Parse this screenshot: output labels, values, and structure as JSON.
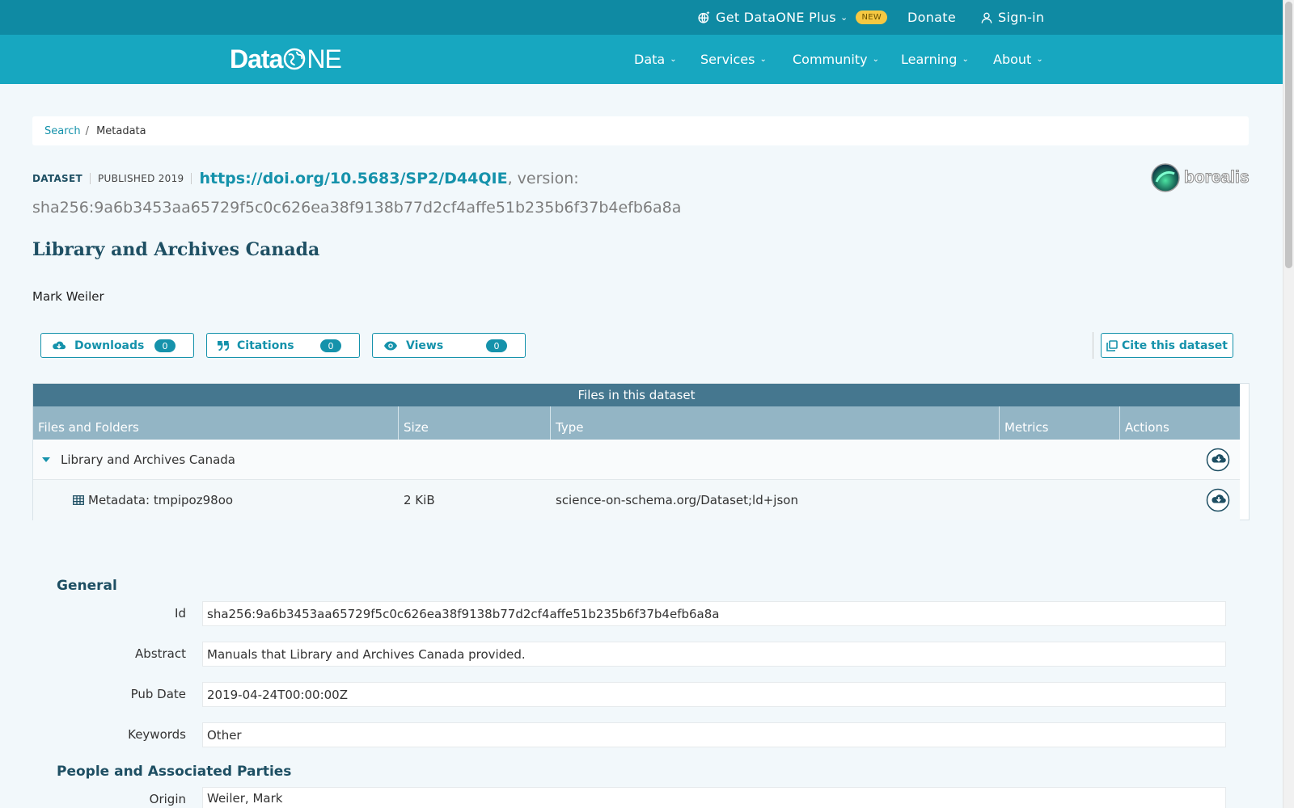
{
  "topbar": {
    "plus_label": "Get DataONE Plus",
    "new_badge": "NEW",
    "donate_label": "Donate",
    "signin_label": "Sign-in"
  },
  "nav": {
    "logo_data": "Data",
    "logo_ne": "NE",
    "items": [
      "Data",
      "Services",
      "Community",
      "Learning",
      "About"
    ]
  },
  "breadcrumb": {
    "search": "Search",
    "separator": "/",
    "current": "Metadata"
  },
  "dataset": {
    "type_label": "DATASET",
    "published_label": "PUBLISHED 2019",
    "doi": "https://doi.org/10.5683/SP2/D44QIE",
    "version_label": ", version:",
    "hash": "sha256:9a6b3453aa65729f5c0c626ea38f9138b77d2cf4affe51b235b6f37b4efb6a8a",
    "repository_logo": "borealis",
    "title": "Library and Archives Canada",
    "author": "Mark Weiler"
  },
  "metrics": {
    "downloads_label": "Downloads",
    "downloads_count": "0",
    "citations_label": "Citations",
    "citations_count": "0",
    "views_label": "Views",
    "views_count": "0",
    "cite_label": "Cite this dataset"
  },
  "files": {
    "caption": "Files in this dataset",
    "columns": [
      "Files and Folders",
      "Size",
      "Type",
      "Metrics",
      "Actions"
    ],
    "folder": {
      "name": "Library and Archives Canada"
    },
    "file": {
      "name": "Metadata: tmpipoz98oo",
      "size": "2 KiB",
      "type": "science-on-schema.org/Dataset;ld+json"
    }
  },
  "general": {
    "title": "General",
    "fields": [
      {
        "label": "Id",
        "value": "sha256:9a6b3453aa65729f5c0c626ea38f9138b77d2cf4affe51b235b6f37b4efb6a8a"
      },
      {
        "label": "Abstract",
        "value": "Manuals that Library and Archives Canada provided."
      },
      {
        "label": "Pub Date",
        "value": "2019-04-24T00:00:00Z"
      },
      {
        "label": "Keywords",
        "value": "Other"
      }
    ]
  },
  "people": {
    "title": "People and Associated Parties",
    "fields": [
      {
        "label": "Origin",
        "value": "Weiler, Mark"
      }
    ]
  },
  "colors": {
    "topbar": "#0f8aa3",
    "navbar": "#17a7c0",
    "accent": "#1592ab",
    "heading": "#1e4f63",
    "table_caption": "#45778f",
    "table_header": "#93b5c5",
    "badge_new": "#f5c842"
  },
  "icons": {
    "plus": "globe-sparkle-icon",
    "signin": "user-icon",
    "downloads": "cloud-download-icon",
    "citations": "quote-icon",
    "views": "eye-icon",
    "cite": "copy-icon",
    "folder_toggle": "caret-down-icon",
    "file": "table-icon",
    "download_action": "circle-download-icon"
  }
}
